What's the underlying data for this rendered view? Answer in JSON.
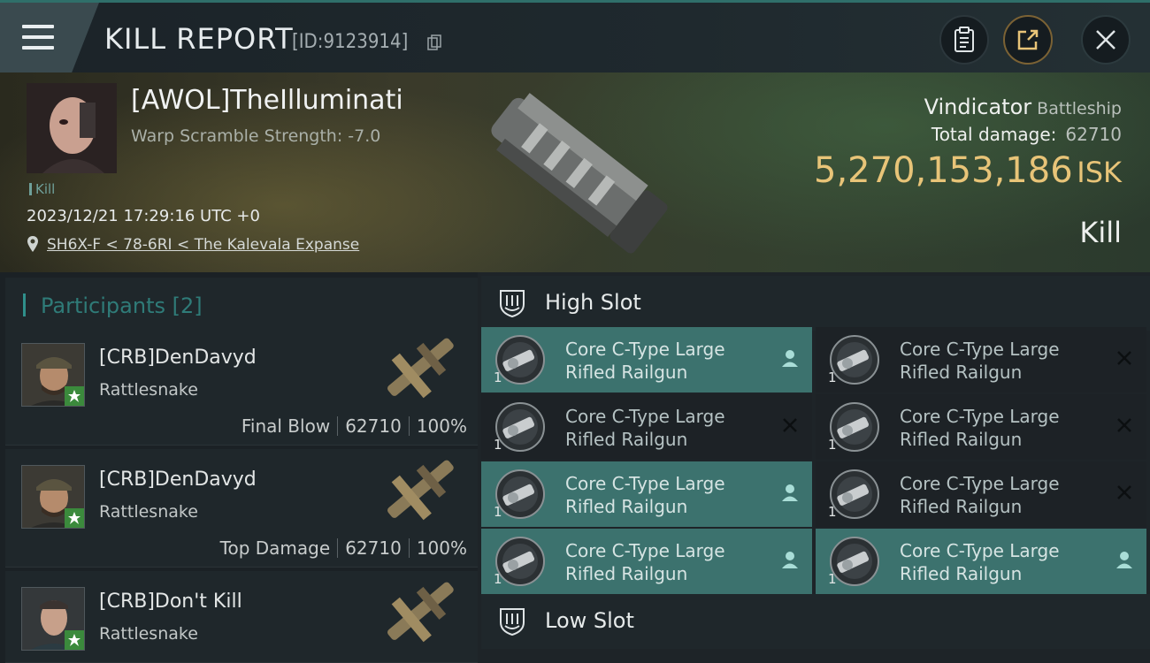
{
  "topbar": {
    "title": "KILL REPORT",
    "report_id": "[ID:9123914]"
  },
  "victim": {
    "name": "[AWOL]TheIlluminati",
    "warp_scramble": "Warp Scramble Strength: -7.0",
    "tag": "Kill",
    "time": "2023/12/21 17:29:16 UTC +0",
    "location": "SH6X-F < 78-6RI < The Kalevala Expanse",
    "ship_name": "Vindicator",
    "ship_class": "Battleship",
    "total_damage_label": "Total damage:",
    "total_damage": "62710",
    "isk_value": "5,270,153,186",
    "isk_unit": "ISK",
    "result": "Kill"
  },
  "participants": {
    "title": "Participants",
    "count": "[2]",
    "rows": [
      {
        "name": "[CRB]DenDavyd",
        "ship": "Rattlesnake",
        "role": "Final Blow",
        "damage": "62710",
        "percent": "100%"
      },
      {
        "name": "[CRB]DenDavyd",
        "ship": "Rattlesnake",
        "role": "Top Damage",
        "damage": "62710",
        "percent": "100%"
      },
      {
        "name": "[CRB]Don't Kill",
        "ship": "Rattlesnake"
      }
    ]
  },
  "slots": {
    "high_title": "High Slot",
    "low_title": "Low Slot",
    "high_modules": [
      {
        "line1": "Core C-Type Large",
        "line2": "Rifled Railgun",
        "qty": "1",
        "status": "user-icon",
        "active": true
      },
      {
        "line1": "Core C-Type Large",
        "line2": "Rifled Railgun",
        "qty": "1",
        "status": "x-icon",
        "active": false
      },
      {
        "line1": "Core C-Type Large",
        "line2": "Rifled Railgun",
        "qty": "1",
        "status": "x-icon",
        "active": false
      },
      {
        "line1": "Core C-Type Large",
        "line2": "Rifled Railgun",
        "qty": "1",
        "status": "x-icon",
        "active": false
      },
      {
        "line1": "Core C-Type Large",
        "line2": "Rifled Railgun",
        "qty": "1",
        "status": "user-icon",
        "active": true
      },
      {
        "line1": "Core C-Type Large",
        "line2": "Rifled Railgun",
        "qty": "1",
        "status": "x-icon",
        "active": false
      },
      {
        "line1": "Core C-Type Large",
        "line2": "Rifled Railgun",
        "qty": "1",
        "status": "user-icon",
        "active": true
      },
      {
        "line1": "Core C-Type Large",
        "line2": "Rifled Railgun",
        "qty": "1",
        "status": "user-icon",
        "active": true
      }
    ]
  },
  "colors": {
    "accent_teal": "#3c726e",
    "isk_gold": "#e8c478",
    "star_green": "#3b8a3c"
  }
}
